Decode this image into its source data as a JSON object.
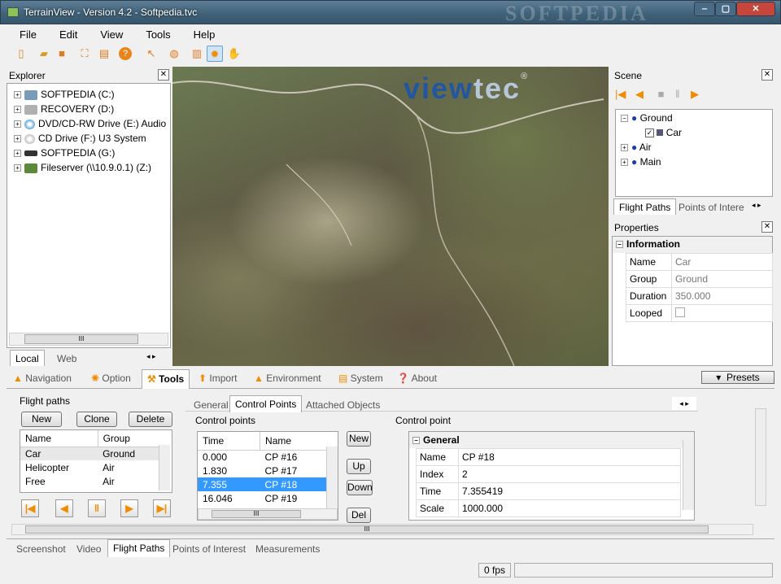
{
  "window": {
    "title": "TerrainView - Version 4.2 - Softpedia.tvc",
    "watermark": "SOFTPEDIA",
    "min": "‒",
    "max": "▢",
    "close": "✕"
  },
  "menu": [
    "File",
    "Edit",
    "View",
    "Tools",
    "Help"
  ],
  "toolbar": {
    "icons": [
      "new-file-icon",
      "open-folder-icon",
      "save-icon",
      "fit-view-icon",
      "layout-icon",
      "help-icon",
      "pointer-icon",
      "globe-icon",
      "terrain-icon",
      "sun-icon",
      "hand-icon"
    ]
  },
  "explorer": {
    "title": "Explorer",
    "drives": [
      "SOFTPEDIA (C:)",
      "RECOVERY (D:)",
      "DVD/CD-RW Drive (E:) Audio",
      "CD Drive (F:) U3 System",
      "SOFTPEDIA (G:)",
      "Fileserver (\\\\10.9.0.1) (Z:)"
    ],
    "tabs": [
      "Local",
      "Web"
    ],
    "scroll_mark": "III"
  },
  "viewport": {
    "logo_a": "view",
    "logo_b": "tec",
    "reg": "®"
  },
  "scene": {
    "title": "Scene",
    "nodes": [
      {
        "label": "Ground",
        "level": 0
      },
      {
        "label": "Car",
        "level": 1
      },
      {
        "label": "Air",
        "level": 0
      },
      {
        "label": "Main",
        "level": 0
      }
    ],
    "tabs": [
      "Flight Paths",
      "Points of Intere"
    ]
  },
  "properties": {
    "title": "Properties",
    "section": "Information",
    "rows": [
      {
        "k": "Name",
        "v": "Car"
      },
      {
        "k": "Group",
        "v": "Ground"
      },
      {
        "k": "Duration",
        "v": "350.000"
      },
      {
        "k": "Looped",
        "v": ""
      }
    ]
  },
  "main_tabs": [
    {
      "label": "Navigation"
    },
    {
      "label": "Option"
    },
    {
      "label": "Tools",
      "active": true
    },
    {
      "label": "Import"
    },
    {
      "label": "Environment"
    },
    {
      "label": "System"
    },
    {
      "label": "About"
    }
  ],
  "presets": "Presets",
  "flight": {
    "group": "Flight paths",
    "buttons": [
      "New",
      "Clone",
      "Delete"
    ],
    "cols": [
      "Name",
      "Group"
    ],
    "rows": [
      [
        "Car",
        "Ground"
      ],
      [
        "Helicopter",
        "Air"
      ],
      [
        "Free",
        "Air"
      ]
    ]
  },
  "sub_tabs": [
    "General",
    "Control Points",
    "Attached Objects"
  ],
  "cp": {
    "group": "Control points",
    "cols": [
      "Time",
      "Name"
    ],
    "rows": [
      [
        "0.000",
        "CP #16"
      ],
      [
        "1.830",
        "CP #17"
      ],
      [
        "7.355",
        "CP #18"
      ],
      [
        "16.046",
        "CP #19"
      ]
    ],
    "buttons": [
      "New",
      "Up",
      "Down",
      "Del"
    ],
    "scroll_mark": "III"
  },
  "cpoint": {
    "group": "Control point",
    "section": "General",
    "rows": [
      {
        "k": "Name",
        "v": "CP #18"
      },
      {
        "k": "Index",
        "v": "2"
      },
      {
        "k": "Time",
        "v": "7.355419"
      },
      {
        "k": "Scale",
        "v": "1000.000"
      }
    ]
  },
  "bottom_scroll_mark": "III",
  "bottom_tabs": [
    "Screenshot",
    "Video",
    "Flight Paths",
    "Points of Interest",
    "Measurements"
  ],
  "status": {
    "fps": "0 fps"
  },
  "colors": {
    "accent": "#3399ff",
    "selection": "#3399ff",
    "orange": "#f08c00"
  }
}
